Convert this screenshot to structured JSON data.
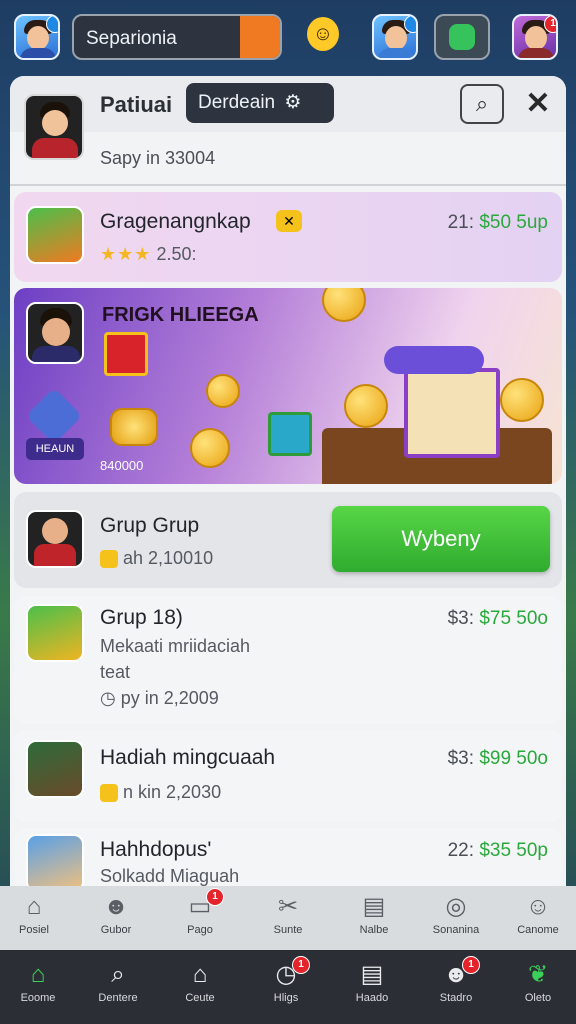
{
  "topbar": {
    "search_label": "Separionia",
    "badges": [
      "",
      "",
      "1"
    ]
  },
  "panel": {
    "title": "Patiuai",
    "dropdown": "Derdeain",
    "subline": "Sapy in 33004"
  },
  "rows": [
    {
      "name": "Gragenangnkap",
      "rating_text": "2.50:",
      "price_prefix": "21:",
      "price": "$50 5up"
    },
    {
      "promo_title": "FRIGK HLIEEGA",
      "tag": "HEAUN",
      "number": "840000"
    },
    {
      "name": "Grup Grup",
      "meta": "ah 2,10010",
      "button": "Wybeny"
    },
    {
      "name": "Grup 18)",
      "desc1": "Mekaati mriidaciah",
      "desc2": "teat",
      "meta": "py in 2,2009",
      "price_prefix": "$3:",
      "price": "$75 50o"
    },
    {
      "name": "Hadiah mingcuaah",
      "meta": "n kin 2,2030",
      "price_prefix": "$3:",
      "price": "$99 50o"
    },
    {
      "name": "Hahhdopus'",
      "desc1": "Solkadd Miaguah",
      "price_prefix": "22:",
      "price": "$35 50p"
    }
  ],
  "nav_primary": [
    {
      "label": "Posiel",
      "icon": "home-icon"
    },
    {
      "label": "Gubor",
      "icon": "avatar-icon"
    },
    {
      "label": "Pago",
      "icon": "gift-icon",
      "badge": "1"
    },
    {
      "label": "Sunte",
      "icon": "tools-icon"
    },
    {
      "label": "Nalbe",
      "icon": "note-icon"
    },
    {
      "label": "Sonanina",
      "icon": "coins-icon"
    },
    {
      "label": "Canome",
      "icon": "profile-icon"
    }
  ],
  "nav_secondary": [
    {
      "label": "Eoome",
      "icon": "home-icon"
    },
    {
      "label": "Dentere",
      "icon": "search-icon"
    },
    {
      "label": "Ceute",
      "icon": "house-icon"
    },
    {
      "label": "Hligs",
      "icon": "clock-icon",
      "badge": "1"
    },
    {
      "label": "Haado",
      "icon": "document-icon"
    },
    {
      "label": "Stadro",
      "icon": "user-icon",
      "badge": "1"
    },
    {
      "label": "Oleto",
      "icon": "leaf-icon"
    }
  ]
}
